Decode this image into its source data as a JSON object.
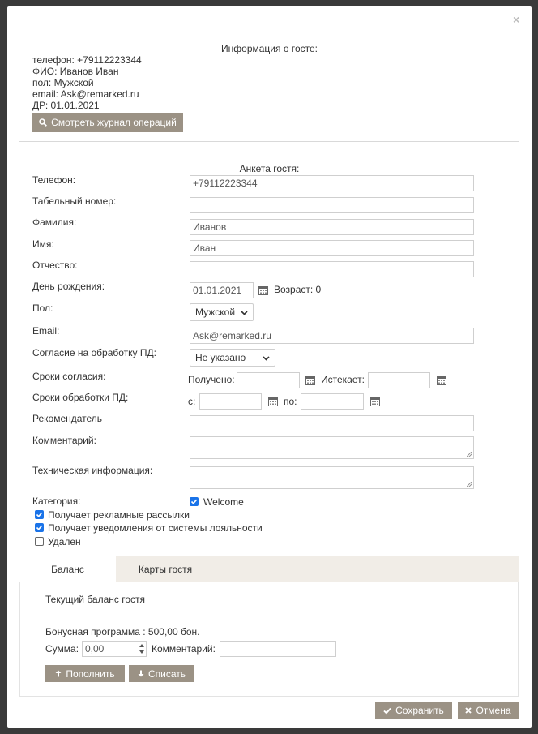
{
  "modal": {
    "close_glyph": "×"
  },
  "guest_info": {
    "title": "Информация о госте:",
    "lines": [
      "телефон: +79112223344",
      "ФИО: Иванов Иван",
      "пол: Мужской",
      "email: Ask@remarked.ru",
      "ДР: 01.01.2021"
    ],
    "journal_button": "Смотреть журнал операций"
  },
  "form": {
    "title": "Анкета гостя:",
    "phone": {
      "label": "Телефон:",
      "value": "+79112223344"
    },
    "tab_number": {
      "label": "Табельный номер:",
      "value": ""
    },
    "surname": {
      "label": "Фамилия:",
      "value": "Иванов"
    },
    "name": {
      "label": "Имя:",
      "value": "Иван"
    },
    "patronymic": {
      "label": "Отчество:",
      "value": ""
    },
    "birthday": {
      "label": "День рождения:",
      "value": "01.01.2021",
      "age_text": "Возраст: 0"
    },
    "gender": {
      "label": "Пол:",
      "value": "Мужской"
    },
    "email": {
      "label": "Email:",
      "value": "Ask@remarked.ru"
    },
    "consent": {
      "label": "Согласие на обработку ПД:",
      "value": "Не указано"
    },
    "consent_dates": {
      "label": "Сроки согласия:",
      "received_label": "Получено:",
      "expires_label": "Истекает:",
      "received": "",
      "expires": ""
    },
    "processing_dates": {
      "label": "Сроки обработки ПД:",
      "from_label": "с:",
      "to_label": "по:",
      "from": "",
      "to": ""
    },
    "referrer": {
      "label": "Рекомендатель",
      "value": ""
    },
    "comment": {
      "label": "Комментарий:",
      "value": ""
    },
    "tech_info": {
      "label": "Техническая информация:",
      "value": ""
    },
    "category": {
      "label": "Категория:",
      "option": "Welcome",
      "checked": true
    },
    "checkboxes": [
      {
        "label": "Получает рекламные рассылки",
        "checked": true
      },
      {
        "label": "Получает уведомления от системы лояльности",
        "checked": true
      },
      {
        "label": "Удален",
        "checked": false
      }
    ]
  },
  "tabs": [
    {
      "label": "Баланс",
      "active": true
    },
    {
      "label": "Карты гостя",
      "active": false
    }
  ],
  "balance": {
    "title": "Текущий баланс гостя",
    "program_text": "Бонусная программа : 500,00 бон.",
    "sum_label": "Сумма:",
    "sum_value": "0,00",
    "comment_label": "Комментарий:",
    "comment_value": "",
    "topup_button": "Пополнить",
    "writeoff_button": "Списать"
  },
  "footer": {
    "save_button": "Сохранить",
    "cancel_button": "Отмена"
  },
  "colors": {
    "button_bg": "#9b9285",
    "checkbox_on": "#1a73e8",
    "tab_bar_bg": "#f1ede7"
  }
}
